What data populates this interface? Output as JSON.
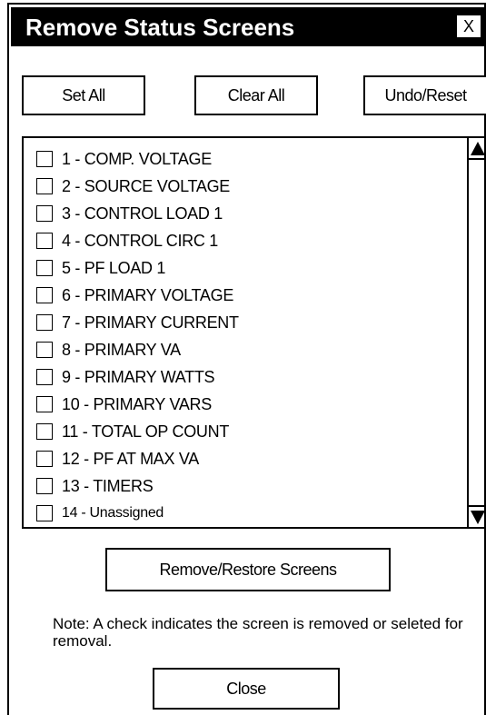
{
  "window": {
    "title": "Remove Status Screens",
    "close_glyph": "X"
  },
  "toolbar": {
    "set_all": "Set All",
    "clear_all": "Clear All",
    "undo_reset": "Undo/Reset"
  },
  "list": {
    "items": [
      {
        "label": "1 - COMP. VOLTAGE",
        "checked": false
      },
      {
        "label": "2 - SOURCE VOLTAGE",
        "checked": false
      },
      {
        "label": "3 - CONTROL LOAD 1",
        "checked": false
      },
      {
        "label": "4 - CONTROL CIRC 1",
        "checked": false
      },
      {
        "label": "5 - PF LOAD 1",
        "checked": false
      },
      {
        "label": "6 - PRIMARY VOLTAGE",
        "checked": false
      },
      {
        "label": "7 - PRIMARY CURRENT",
        "checked": false
      },
      {
        "label": "8 - PRIMARY VA",
        "checked": false
      },
      {
        "label": "9 - PRIMARY WATTS",
        "checked": false
      },
      {
        "label": "10 - PRIMARY VARS",
        "checked": false
      },
      {
        "label": "11 - TOTAL OP COUNT",
        "checked": false
      },
      {
        "label": "12 - PF AT MAX VA",
        "checked": false
      },
      {
        "label": "13 - TIMERS",
        "checked": false
      },
      {
        "label": "14 - Unassigned",
        "checked": false
      }
    ],
    "scroll_up_icon": "scroll-up-arrow-icon",
    "scroll_down_icon": "scroll-down-arrow-icon"
  },
  "actions": {
    "remove_restore": "Remove/Restore Screens",
    "close": "Close"
  },
  "note": {
    "text": "Note: A check indicates the screen is removed or seleted for removal."
  }
}
